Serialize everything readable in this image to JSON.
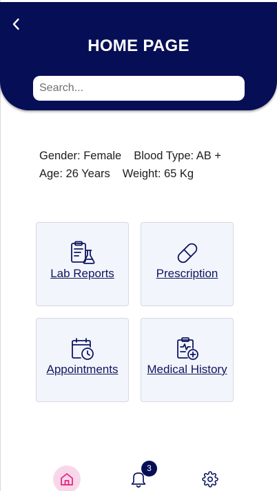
{
  "header": {
    "title": "HOME PAGE",
    "search_placeholder": "Search..."
  },
  "profile": {
    "gender": "Gender: Female",
    "blood_type": "Blood Type: AB +",
    "age": "Age: 26 Years",
    "weight": "Weight: 65 Kg"
  },
  "cards": [
    {
      "label": "Lab Reports",
      "icon": "lab-reports-icon"
    },
    {
      "label": "Prescription",
      "icon": "pill-icon"
    },
    {
      "label": "Appointments",
      "icon": "calendar-clock-icon"
    },
    {
      "label": "Medical History",
      "icon": "clipboard-health-icon"
    }
  ],
  "nav": {
    "home_icon": "home-icon",
    "bell_icon": "bell-icon",
    "notification_count": "3",
    "settings_icon": "gear-icon"
  },
  "colors": {
    "primary": "#060f55",
    "card_bg": "#f3f5fc",
    "home_active": "#f9d7ea",
    "home_icon": "#e0217a"
  }
}
